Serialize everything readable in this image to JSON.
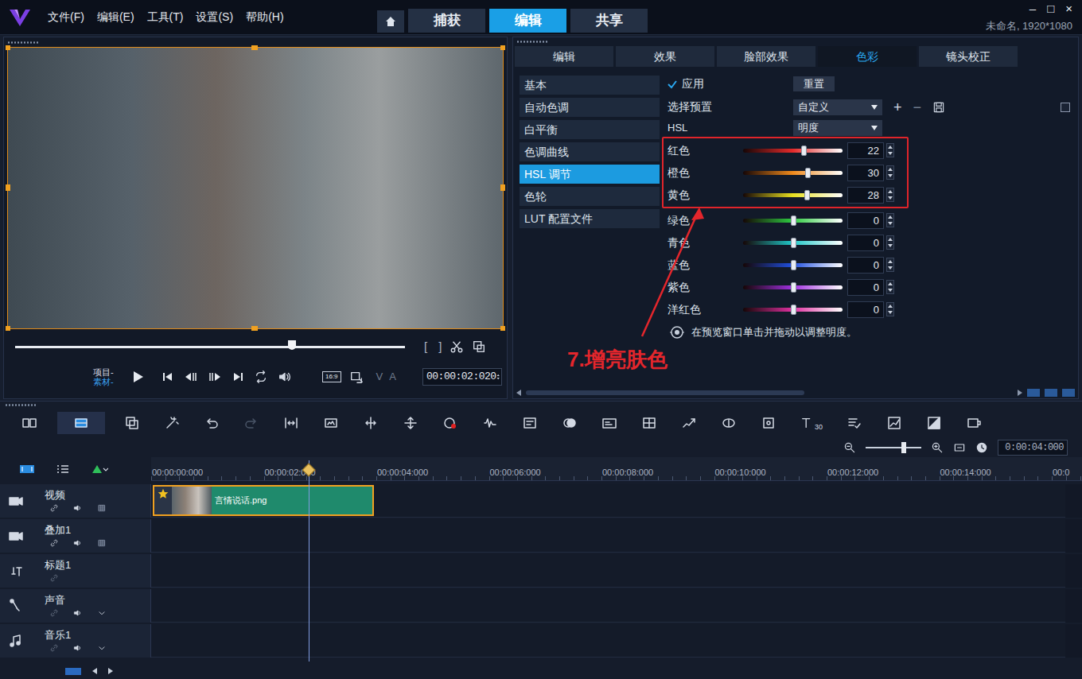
{
  "menu": [
    "文件(F)",
    "编辑(E)",
    "工具(T)",
    "设置(S)",
    "帮助(H)"
  ],
  "main_tabs": [
    {
      "label": "捕获",
      "selected": false
    },
    {
      "label": "编辑",
      "selected": true
    },
    {
      "label": "共享",
      "selected": false
    }
  ],
  "window_controls": [
    "–",
    "□",
    "×"
  ],
  "project_info": "未命名, 1920*1080",
  "preview": {
    "scrubber_level": 0.71,
    "trim_marks": [
      "[",
      "]"
    ],
    "mode_labels": [
      {
        "label": "项目-",
        "selected": false
      },
      {
        "label": "素材-",
        "selected": true
      }
    ],
    "aspect": "16:9",
    "track_toggles": [
      "V",
      "A"
    ],
    "timecode": "00:00:02:020"
  },
  "panel_tabs": [
    {
      "label": "编辑",
      "selected": false
    },
    {
      "label": "效果",
      "selected": false
    },
    {
      "label": "脸部效果",
      "selected": false
    },
    {
      "label": "色彩",
      "selected": true
    },
    {
      "label": "镜头校正",
      "selected": false
    }
  ],
  "categories": [
    {
      "label": "基本",
      "selected": false
    },
    {
      "label": "自动色调",
      "selected": false
    },
    {
      "label": "白平衡",
      "selected": false
    },
    {
      "label": "色调曲线",
      "selected": false
    },
    {
      "label": "HSL 调节",
      "selected": true
    },
    {
      "label": "色轮",
      "selected": false
    },
    {
      "label": "LUT 配置文件",
      "selected": false
    }
  ],
  "apply": {
    "label": "应用",
    "checked": true
  },
  "reset": "重置",
  "preset": {
    "label": "选择预置",
    "value": "自定义",
    "add": "+",
    "remove": "−"
  },
  "extra_checkbox": {
    "checked": false
  },
  "hsl": {
    "label": "HSL",
    "value": "明度"
  },
  "sliders": [
    {
      "name": "红色",
      "value": "22",
      "level": 0.61,
      "color": "#e52a2a",
      "annotated": true
    },
    {
      "name": "橙色",
      "value": "30",
      "level": 0.65,
      "color": "#f08a1c",
      "annotated": true
    },
    {
      "name": "黄色",
      "value": "28",
      "level": 0.64,
      "color": "#e8e020",
      "annotated": true
    },
    {
      "name": "绿色",
      "value": "0",
      "level": 0.5,
      "color": "#2ecc40",
      "annotated": false
    },
    {
      "name": "青色",
      "value": "0",
      "level": 0.5,
      "color": "#20c8c8",
      "annotated": false
    },
    {
      "name": "蓝色",
      "value": "0",
      "level": 0.5,
      "color": "#2050e0",
      "annotated": false
    },
    {
      "name": "紫色",
      "value": "0",
      "level": 0.5,
      "color": "#a030e0",
      "annotated": false
    },
    {
      "name": "洋红色",
      "value": "0",
      "level": 0.5,
      "color": "#e030a0",
      "annotated": false
    }
  ],
  "hint": "在预览窗口单击并拖动以调整明度。",
  "annotation": "7.增亮肤色",
  "toolbar": {
    "view_modes": [
      {
        "selected": false
      },
      {
        "selected": true
      }
    ],
    "redo_disabled": true,
    "title_badge": "30"
  },
  "timeline": {
    "zoom_level": 0.68,
    "zoom_time": "0:00:04:000",
    "ruler": [
      "00:00:00:000",
      "00:00:02:000",
      "00:00:04:000",
      "00:00:06:000",
      "00:00:08:000",
      "00:00:10:000",
      "00:00:12:000",
      "00:00:14:000",
      "00:0"
    ],
    "playhead_seconds": 2.8,
    "tracks": [
      "视频",
      "叠加1",
      "标题1",
      "声音",
      "音乐1"
    ],
    "clip": {
      "track": 0,
      "name": "言情说话.png",
      "start": 0,
      "end": 3.93,
      "selected": true
    }
  }
}
